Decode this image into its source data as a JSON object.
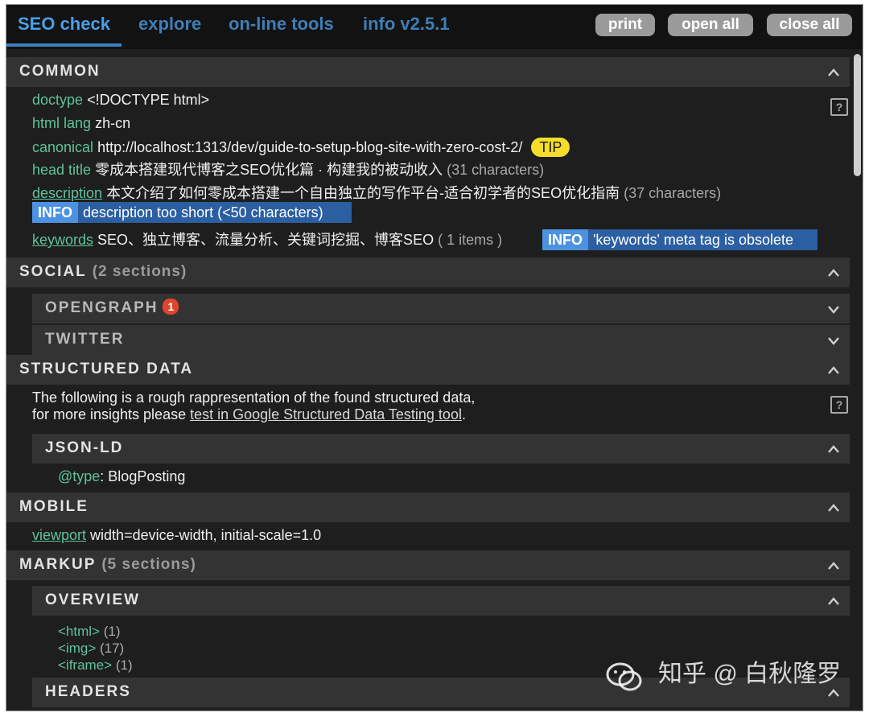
{
  "tabs": [
    {
      "label": "SEO check",
      "active": true
    },
    {
      "label": "explore"
    },
    {
      "label": "on-line tools"
    },
    {
      "label": "info v2.5.1"
    }
  ],
  "buttons": {
    "print": "print",
    "open_all": "open all",
    "close_all": "close all"
  },
  "common": {
    "title": "COMMON",
    "doctype": {
      "label": "doctype",
      "value": "<!DOCTYPE html>"
    },
    "html_lang": {
      "label": "html lang",
      "value": "zh-cn"
    },
    "canonical": {
      "label": "canonical",
      "value": "http://localhost:1313/dev/guide-to-setup-blog-site-with-zero-cost-2/",
      "tip": "TIP"
    },
    "head_title": {
      "label": "head title",
      "value": "零成本搭建现代博客之SEO优化篇 · 构建我的被动收入",
      "count": "(31 characters)"
    },
    "description": {
      "label": "description",
      "value": "本文介绍了如何零成本搭建一个自由独立的写作平台-适合初学者的SEO优化指南",
      "count": "(37 characters)",
      "info_badge": "INFO",
      "info_text": "description too short (<50 characters)"
    },
    "keywords": {
      "label": "keywords",
      "value": "SEO、独立博客、流量分析、关键词挖掘、博客SEO",
      "count": "( 1 items )",
      "info_badge": "INFO",
      "info_text": "'keywords' meta tag is obsolete"
    }
  },
  "social": {
    "title": "SOCIAL",
    "count": "(2 sections)",
    "opengraph": {
      "title": "OPENGRAPH",
      "badge": "1"
    },
    "twitter": {
      "title": "TWITTER"
    }
  },
  "structured": {
    "title": "STRUCTURED DATA",
    "text1": "The following is a rough rappresentation of the found structured data,",
    "text2_prefix": "for more insights please ",
    "text2_link": "test in Google Structured Data Testing tool",
    "text2_suffix": ".",
    "jsonld": {
      "title": "JSON-LD",
      "type_label": "@type",
      "type_value": ": BlogPosting"
    }
  },
  "mobile": {
    "title": "MOBILE",
    "viewport": {
      "label": "viewport",
      "value": "width=device-width, initial-scale=1.0"
    }
  },
  "markup": {
    "title": "MARKUP",
    "count": "(5 sections)",
    "overview": {
      "title": "OVERVIEW",
      "items": [
        {
          "tag": "<html>",
          "count": "(1)"
        },
        {
          "tag": "<img>",
          "count": "(17)"
        },
        {
          "tag": "<iframe>",
          "count": "(1)"
        }
      ]
    },
    "headers": {
      "title": "HEADERS"
    }
  },
  "help_icon": "?",
  "watermark": "知乎 @ 白秋隆罗",
  "icons": [
    "chevron-up-icon",
    "chevron-down-icon",
    "question-icon",
    "wechat-icon"
  ],
  "colors": {
    "label_green": "#5fc29a",
    "tab_blue": "#4a9fe6",
    "info_blue": "#2b5fa2",
    "tip_yellow": "#f5dd2c",
    "badge_red": "#e0452c"
  }
}
